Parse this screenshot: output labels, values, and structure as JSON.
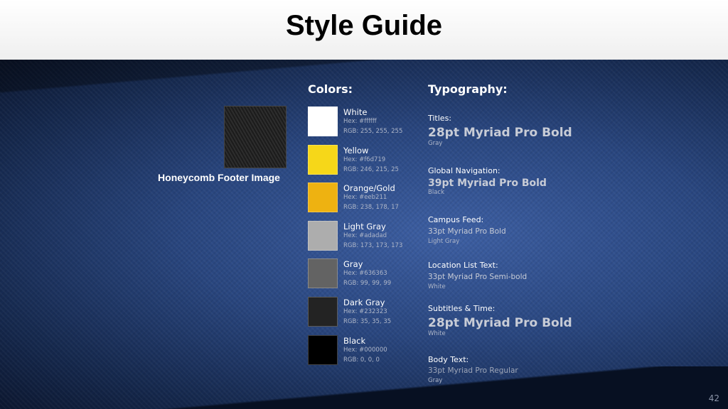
{
  "slide": {
    "title": "Style Guide",
    "page_number": "42"
  },
  "footer_image": {
    "caption": "Honeycomb Footer Image"
  },
  "colors": {
    "heading": "Colors:",
    "items": [
      {
        "name": "White",
        "hex": "Hex: #ffffff",
        "rgb": "RGB: 255, 255, 255",
        "swatch": "#ffffff"
      },
      {
        "name": "Yellow",
        "hex": "Hex: #f6d719",
        "rgb": "RGB: 246, 215, 25",
        "swatch": "#f6d719"
      },
      {
        "name": "Orange/Gold",
        "hex": "Hex: #eeb211",
        "rgb": "RGB: 238, 178, 17",
        "swatch": "#eeb211"
      },
      {
        "name": "Light Gray",
        "hex": "Hex: #adadad",
        "rgb": "RGB: 173, 173, 173",
        "swatch": "#adadad"
      },
      {
        "name": "Gray",
        "hex": "Hex: #636363",
        "rgb": "RGB: 99, 99, 99",
        "swatch": "#636363"
      },
      {
        "name": "Dark Gray",
        "hex": "Hex: #232323",
        "rgb": "RGB: 35, 35, 35",
        "swatch": "#232323"
      },
      {
        "name": "Black",
        "hex": "Hex: #000000",
        "rgb": "RGB: 0, 0, 0",
        "swatch": "#000000"
      }
    ]
  },
  "typography": {
    "heading": "Typography:",
    "items": [
      {
        "label": "Titles:",
        "sample": "28pt Myriad Pro Bold",
        "note": "Gray"
      },
      {
        "label": "Global Navigation:",
        "sample": "39pt Myriad Pro Bold",
        "note": "Black"
      },
      {
        "label": "Campus Feed:",
        "sample": "33pt Myriad Pro Bold",
        "note": "Light Gray"
      },
      {
        "label": "Location List Text:",
        "sample": "33pt Myriad Pro Semi-bold",
        "note": "White"
      },
      {
        "label": "Subtitles & Time:",
        "sample": "28pt Myriad Pro Bold",
        "note": "White"
      },
      {
        "label": "Body Text:",
        "sample": "33pt Myriad Pro Regular",
        "note": "Gray"
      }
    ]
  }
}
